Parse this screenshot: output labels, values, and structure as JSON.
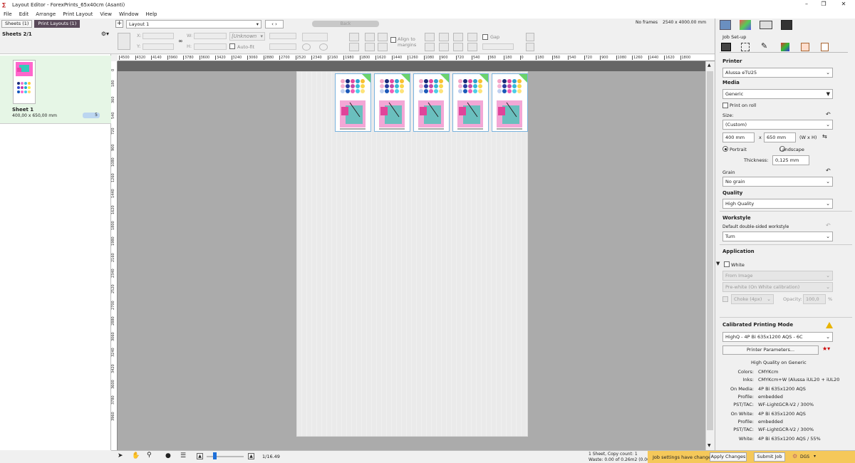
{
  "window": {
    "title": "Layout Editor - ForexPrints_65x40cm (Asanti)"
  },
  "menu": [
    "File",
    "Edit",
    "Arrange",
    "Print Layout",
    "View",
    "Window",
    "Help"
  ],
  "left": {
    "tabs": [
      "Sheets (1)",
      "Print Layouts (1)"
    ],
    "header": "Sheets 2/1",
    "sheet": {
      "name": "Sheet 1",
      "size": "400,00 x 650,00 mm",
      "count": "5"
    }
  },
  "toolbar": {
    "layout": "Layout 1",
    "unknown": "[Unknown",
    "autofit": "Auto-fit",
    "back": "Back",
    "align_to": "Align to",
    "margins": "margins",
    "gap": "Gap",
    "x_lbl": "X:",
    "y_lbl": "Y:",
    "w_lbl": "W:",
    "h_lbl": "H:",
    "no_frames": "No frames",
    "dimensions": "2540 x 4000.00 mm"
  },
  "ruler_h": [
    "4500",
    "4320",
    "4140",
    "3960",
    "3780",
    "3600",
    "3420",
    "3240",
    "3060",
    "2880",
    "2700",
    "2520",
    "2340",
    "2160",
    "1980",
    "1800",
    "1620",
    "1440",
    "1260",
    "1080",
    "900",
    "720",
    "540",
    "360",
    "180",
    "0",
    "180",
    "360",
    "540",
    "720",
    "900",
    "1080",
    "1260",
    "1440",
    "1620",
    "1800"
  ],
  "ruler_v": [
    "0",
    "180",
    "360",
    "540",
    "720",
    "900",
    "1080",
    "1260",
    "1440",
    "1620",
    "1800",
    "1980",
    "2160",
    "2340",
    "2520",
    "2700",
    "2880",
    "3060",
    "3240",
    "3420",
    "3600",
    "3780",
    "3960"
  ],
  "right": {
    "tab_title": "Job Set-up",
    "printer_h": "Printer",
    "printer": "Alussa eTU25",
    "media_h": "Media",
    "media": "Generic",
    "print_on_roll": "Print on roll",
    "size_lbl": "Size:",
    "size": "(Custom)",
    "width": "400 mm",
    "x": "x",
    "height": "650 mm",
    "wxh": "(W x H)",
    "portrait": "Portrait",
    "landscape": "Landscape",
    "thickness_lbl": "Thickness:",
    "thickness": "0,125 mm",
    "grain_lbl": "Grain",
    "grain": "No grain",
    "quality_h": "Quality",
    "quality": "High Quality",
    "workstyle_h": "Workstyle",
    "workstyle_lbl": "Default double-sided workstyle",
    "workstyle": "Turn",
    "application_h": "Application",
    "white": "White",
    "from_image": "From Image",
    "prewhite": "Pre-white (On White calibration)",
    "choke": "Choke (4px)",
    "opacity_lbl": "Opacity:",
    "opacity": "100,0",
    "opacity_unit": "%",
    "cpm_h": "Calibrated Printing Mode",
    "cpm": "HighQ - 4P Bi 635x1200 AQS - 6C",
    "printer_params": "Printer Parameters...",
    "hq_on_generic": "High Quality on Generic",
    "info": [
      {
        "k": "Colors:",
        "v": "CMYKcm"
      },
      {
        "k": "Inks:",
        "v": "CMYKcm+W (Alussa iUL20 + iUL20"
      },
      {
        "k": "On Media:",
        "v": "4P Bi 635x1200 AQS"
      },
      {
        "k": "Profile:",
        "v": "embedded"
      },
      {
        "k": "PST/TAC:",
        "v": "WF-LightGCR-V2 /  300%"
      },
      {
        "k": "On White:",
        "v": "4P Bi 635x1200 AQS"
      },
      {
        "k": "Profile:",
        "v": "embedded"
      },
      {
        "k": "PST/TAC:",
        "v": "WF-LightGCR-V2 /  300%"
      },
      {
        "k": "White:",
        "v": "4P Bi 635x1200 AQS /  55%"
      }
    ]
  },
  "status": {
    "zoom": "1/16.49",
    "sheets_copy": "1 Sheet, Copy count: 1",
    "waste": "Waste: 0.00 of 0.26m2 (0.00%)",
    "job_changed": "Job settings have changed",
    "apply": "Apply Changes",
    "submit": "Submit Job",
    "dgs": "DGS"
  },
  "colors": {
    "accent": "#5a4a5a",
    "warn": "#f5c85a",
    "sheet_sel": "#e6f6e6",
    "frame_border": "#7ab3de"
  }
}
